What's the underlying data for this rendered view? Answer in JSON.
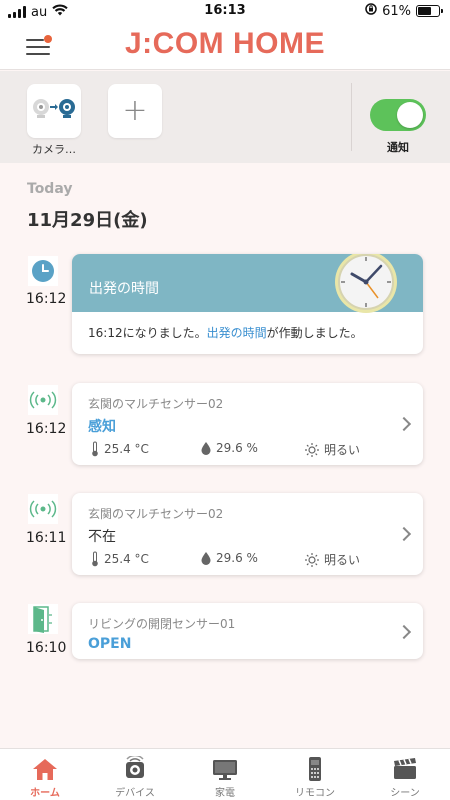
{
  "status_bar": {
    "carrier": "au",
    "time": "16:13",
    "battery": "61%"
  },
  "header": {
    "logo": "J:COM HOME"
  },
  "device_bar": {
    "camera_label": "カメラ…",
    "notify_label": "通知",
    "notify_on": true
  },
  "timeline": {
    "section": "Today",
    "date": "11月29日(金)",
    "events": [
      {
        "time": "16:12",
        "title": "出発の時間",
        "message_prefix": "16:12になりました。",
        "message_link": "出発の時間",
        "message_suffix": "が作動しました。"
      },
      {
        "time": "16:12",
        "title": "玄関のマルチセンサー02",
        "state": "感知",
        "temperature": "25.4 °C",
        "humidity": "29.6 %",
        "brightness": "明るい"
      },
      {
        "time": "16:11",
        "title": "玄関のマルチセンサー02",
        "state": "不在",
        "temperature": "25.4 °C",
        "humidity": "29.6 %",
        "brightness": "明るい"
      },
      {
        "time": "16:10",
        "title": "リビングの開閉センサー01",
        "state": "OPEN"
      }
    ]
  },
  "tabs": [
    {
      "label": "ホーム",
      "icon": "home-icon",
      "active": true
    },
    {
      "label": "デバイス",
      "icon": "device-icon"
    },
    {
      "label": "家電",
      "icon": "tv-icon"
    },
    {
      "label": "リモコン",
      "icon": "remote-icon"
    },
    {
      "label": "シーン",
      "icon": "scene-icon"
    }
  ],
  "colors": {
    "brand": "#e66a5a",
    "toggle_on": "#5dc25a",
    "alarm_header": "#7fb6c4",
    "state_blue": "#4a9fd8",
    "sensor_green": "#5cb88a"
  }
}
